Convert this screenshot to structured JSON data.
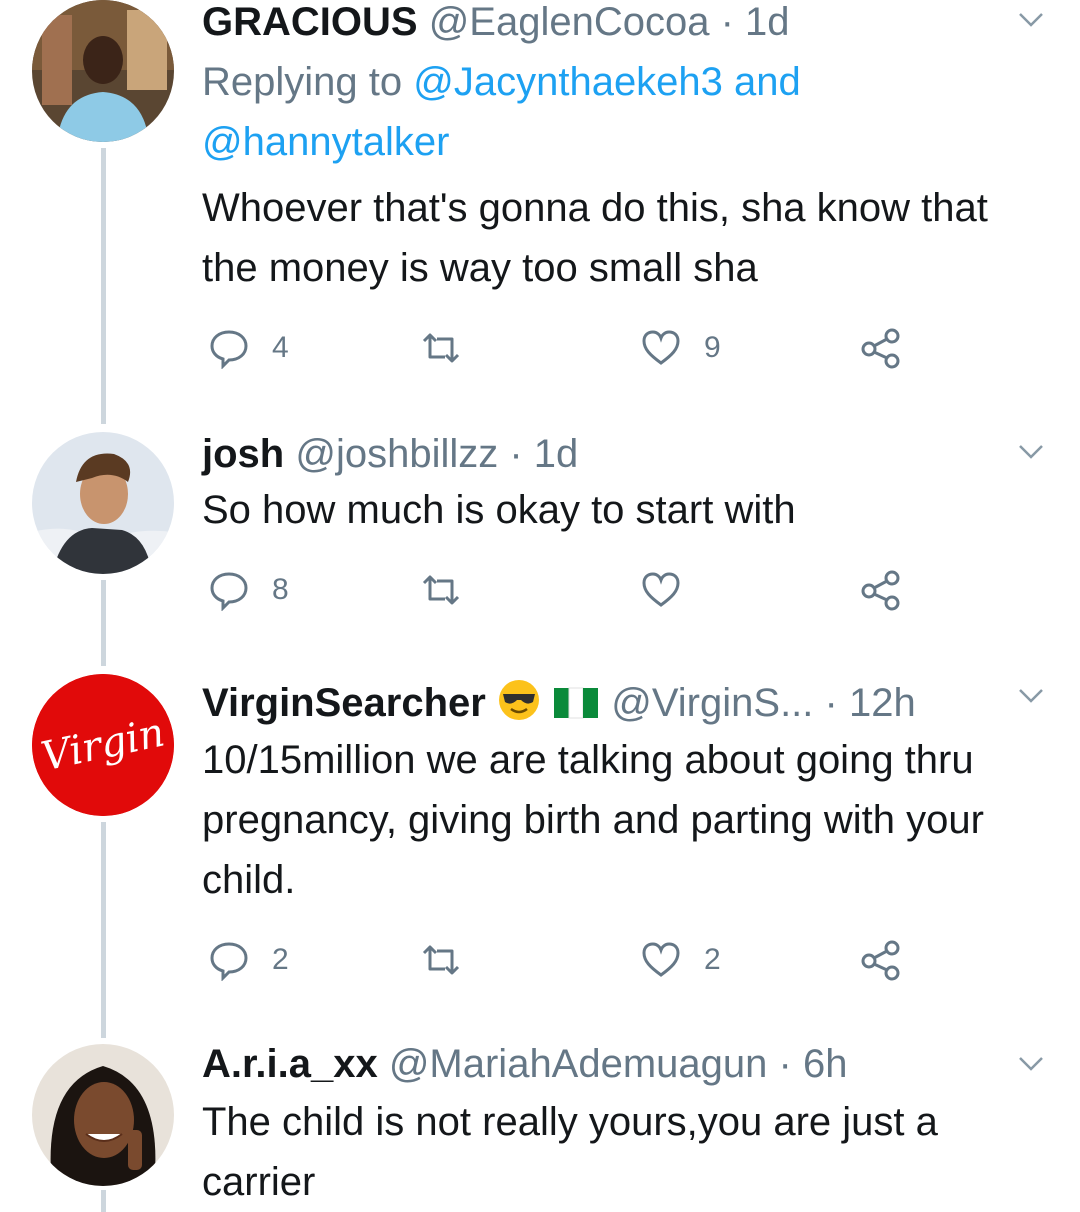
{
  "tweets": [
    {
      "name": "GRACIOUS",
      "handle": "@EaglenCocoa",
      "time": "· 1d",
      "reply_prefix": "Replying to ",
      "reply_user1": "@Jacynthaekeh3",
      "reply_and": "and",
      "reply_user2": "@hannytalker",
      "body": "Whoever that's gonna do this, sha know that the money is way too small sha",
      "replies": "4",
      "likes": "9"
    },
    {
      "name": "josh",
      "handle": "@joshbillzz",
      "time": "· 1d",
      "body": "So how much is okay to start with",
      "replies": "8"
    },
    {
      "name": "VirginSearcher",
      "handle": "@VirginS...",
      "time": "· 12h",
      "avatar_logo": "Virgin",
      "body": "10/15million we are talking about going thru pregnancy, giving birth and parting with your child.",
      "replies": "2",
      "likes": "2"
    },
    {
      "name": "A.r.i.a_xx",
      "handle": "@MariahAdemuagun",
      "time": "· 6h",
      "body": "The child is not really yours,you are just a carrier"
    }
  ],
  "icons": {
    "reply": "reply-icon",
    "retweet": "retweet-icon",
    "like": "heart-icon",
    "share": "share-icon",
    "more": "chevron-down-icon"
  },
  "colors": {
    "text": "#14171a",
    "secondary": "#657786",
    "link": "#1da1f2",
    "thread_line": "#cdd6dd",
    "virgin_red": "#e10a0a"
  }
}
